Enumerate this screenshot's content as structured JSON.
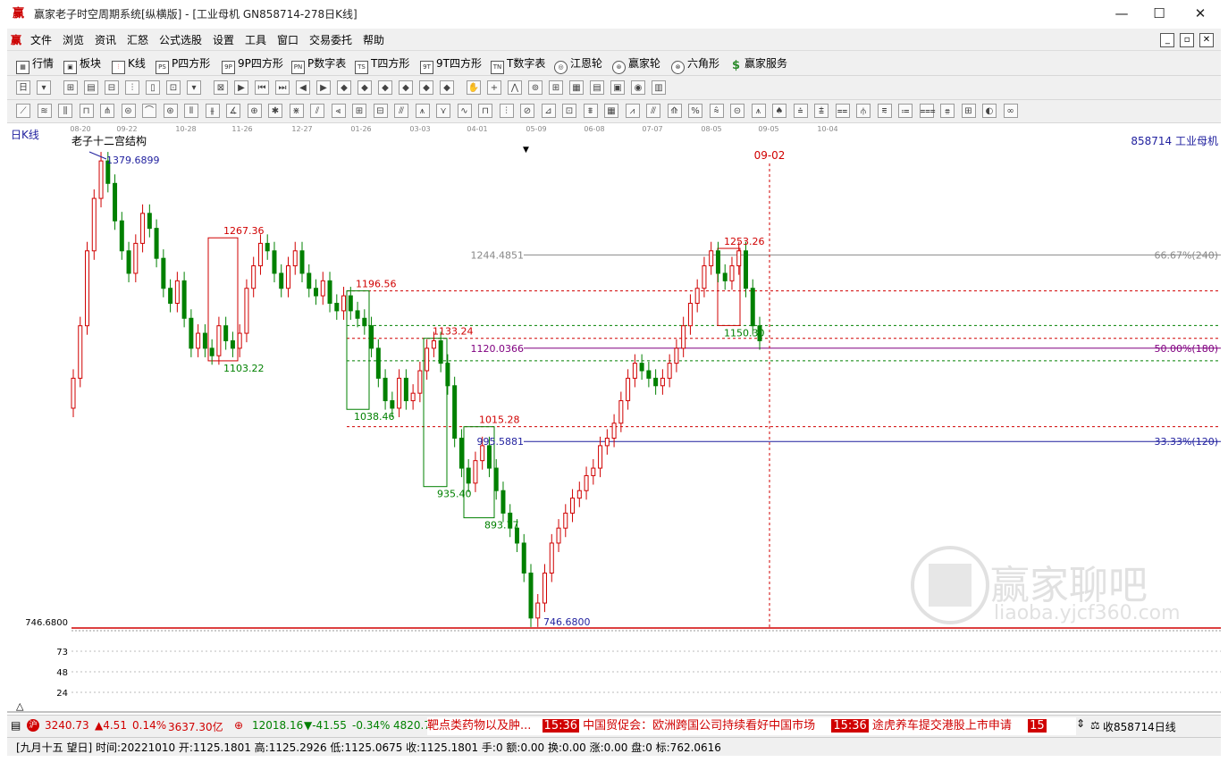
{
  "window": {
    "title": "赢家老子时空周期系统[纵横版] - [工业母机  GN858714-278日K线]",
    "app_icon": "赢",
    "minimize": "—",
    "maximize": "☐",
    "close": "✕"
  },
  "menu": [
    "文件",
    "浏览",
    "资讯",
    "汇怒",
    "公式选股",
    "设置",
    "工具",
    "窗口",
    "交易委托",
    "帮助"
  ],
  "menu_icon": "赢",
  "mdi_buttons": [
    "_",
    "▫",
    "✕"
  ],
  "nav_toolbar": [
    {
      "label": "行情",
      "icon": "grid-icon"
    },
    {
      "label": "板块",
      "icon": "blocks-icon"
    },
    {
      "label": "K线",
      "icon": "candles-icon"
    },
    {
      "label": "P四方形",
      "icon": "ps-icon",
      "glyph": "PS"
    },
    {
      "label": "9P四方形",
      "icon": "9p-icon",
      "glyph": "9P"
    },
    {
      "label": "P数字表",
      "icon": "pn-icon",
      "glyph": "PN"
    },
    {
      "label": "T四方形",
      "icon": "ts-icon",
      "glyph": "TS"
    },
    {
      "label": "9T四方形",
      "icon": "9t-icon",
      "glyph": "9T"
    },
    {
      "label": "T数字表",
      "icon": "tn-icon",
      "glyph": "TN"
    },
    {
      "label": "江恩轮",
      "icon": "gann-wheel-icon",
      "glyph": "◎"
    },
    {
      "label": "赢家轮",
      "icon": "winner-wheel-icon",
      "glyph": "⊛"
    },
    {
      "label": "六角形",
      "icon": "hexagon-icon",
      "glyph": "⊗"
    },
    {
      "label": "赢家服务",
      "icon": "dollar-icon",
      "glyph": "$"
    }
  ],
  "chart": {
    "period_label": "日K线",
    "structure_label": "老子十二宫结构",
    "symbol_label": "858714  工业母机",
    "date_ticks": [
      "08-20",
      "09-22",
      "10-28",
      "11-26",
      "12-27",
      "01-26",
      "03-03",
      "04-01",
      "05-09",
      "06-08",
      "07-07",
      "08-05",
      "09-05",
      "10-04"
    ],
    "cursor_date": "09-02",
    "price_labels": {
      "high": "1379.6899",
      "low": "746.6800",
      "low_axis": "746.6800",
      "box_highs": [
        "1267.36",
        "1196.56",
        "1133.24",
        "1015.28",
        "1253.26"
      ],
      "box_lows": [
        "1103.22",
        "1038.46",
        "935.40",
        "893.77",
        "1150.30"
      ],
      "fib_levels": [
        {
          "price": "1244.4851",
          "label": "66.67%(240)"
        },
        {
          "price": "1120.0366",
          "label": "50.00%(180)"
        },
        {
          "price": "995.5881",
          "label": "33.33%(120)"
        }
      ]
    },
    "volume_axis": [
      "73",
      "48",
      "24"
    ],
    "volume_up_arrow": "△"
  },
  "status": {
    "sh_index": "3240.73",
    "sh_change": "▲4.51",
    "sh_pct": "0.14%",
    "sh_amount": "3637.30亿",
    "sz_index": "12018.16",
    "sz_change": "▼-41.55",
    "sz_pct": "-0.34%",
    "sz_amount": "4820.77",
    "news": [
      {
        "time": "",
        "text": "靶点类药物以及肿..."
      },
      {
        "time": "15:36",
        "text": "中国贸促会：欧洲跨国公司持续看好中国市场"
      },
      {
        "time": "15:36",
        "text": "途虎养车提交港股上市申请"
      },
      {
        "time": "15",
        "text": ""
      }
    ],
    "scroll_glyph": "⇕",
    "right_label": "收858714日线"
  },
  "info": "[九月十五  望日] 时间:20221010 开:1125.1801 高:1125.2926 低:1125.0675 收:1125.1801 手:0 额:0.00 换:0.00 涨:0.00 盘:0 标:762.0616",
  "watermark": {
    "seal": "财赢富家",
    "title": "赢家聊吧",
    "url": "liaoba.yjcf360.com"
  },
  "colors": {
    "up": "#d00000",
    "down": "#008000",
    "fib_line": "#800080",
    "blue_line": "#1f1f9e",
    "gray_line": "#888888"
  },
  "chart_data": {
    "type": "candlestick",
    "title": "老子十二宫结构",
    "symbol": "858714 工业母机",
    "x_ticks": [
      "08-20",
      "09-22",
      "10-28",
      "11-26",
      "12-27",
      "01-26",
      "03-03",
      "04-01",
      "05-09",
      "06-08",
      "07-07",
      "08-05",
      "09-05",
      "10-04"
    ],
    "ylim": [
      746.68,
      1379.6899
    ],
    "closes": [
      1080,
      1150,
      1250,
      1320,
      1370,
      1340,
      1290,
      1250,
      1220,
      1260,
      1300,
      1280,
      1240,
      1200,
      1180,
      1210,
      1160,
      1120,
      1140,
      1120,
      1110,
      1150,
      1130,
      1120,
      1140,
      1200,
      1230,
      1260,
      1250,
      1220,
      1200,
      1230,
      1250,
      1220,
      1200,
      1190,
      1210,
      1180,
      1170,
      1190,
      1170,
      1160,
      1150,
      1120,
      1080,
      1050,
      1040,
      1080,
      1050,
      1060,
      1090,
      1120,
      1130,
      1100,
      1070,
      1000,
      960,
      940,
      970,
      990,
      960,
      930,
      900,
      880,
      860,
      820,
      760,
      780,
      820,
      860,
      880,
      900,
      920,
      930,
      950,
      960,
      990,
      1000,
      1020,
      1050,
      1080,
      1100,
      1090,
      1080,
      1070,
      1080,
      1100,
      1120,
      1150,
      1180,
      1200,
      1230,
      1250,
      1220,
      1210,
      1230,
      1250,
      1200,
      1150,
      1130
    ],
    "boxes": [
      {
        "high": 1267.36,
        "low": 1103.22,
        "color": "red"
      },
      {
        "high": 1196.56,
        "low": 1038.46,
        "color": "green"
      },
      {
        "high": 1133.24,
        "low": 935.4,
        "color": "green"
      },
      {
        "high": 1015.28,
        "low": 893.77,
        "color": "green"
      },
      {
        "high": 1253.26,
        "low": 1150.3,
        "color": "red"
      }
    ],
    "horizontal_levels": [
      {
        "price": 1244.4851,
        "label": "66.67%(240)"
      },
      {
        "price": 1120.0366,
        "label": "50.00%(180)"
      },
      {
        "price": 995.5881,
        "label": "33.33%(120)"
      },
      {
        "price": 746.68,
        "label": "746.6800"
      }
    ],
    "cursor": "09-02"
  }
}
